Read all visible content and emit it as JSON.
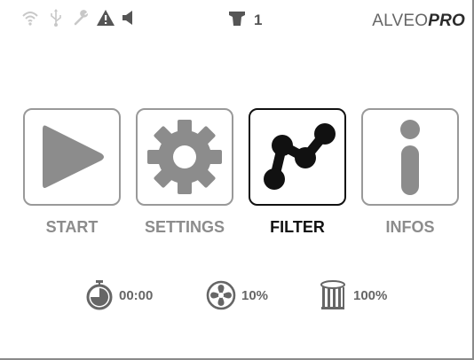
{
  "status_bar": {
    "icons": [
      "wifi-icon",
      "usb-icon",
      "wrench-icon",
      "warning-icon",
      "speaker-icon",
      "dock-icon"
    ],
    "dock_count": "1",
    "brand_light": "ALVEO",
    "brand_bold": "PRO"
  },
  "menu": {
    "items": [
      {
        "label": "START",
        "icon": "play-icon",
        "active": false
      },
      {
        "label": "SETTINGS",
        "icon": "gear-icon",
        "active": false
      },
      {
        "label": "FILTER",
        "icon": "filter-graph-icon",
        "active": true
      },
      {
        "label": "INFOS",
        "icon": "info-icon",
        "active": false
      }
    ]
  },
  "stats": {
    "timer": "00:00",
    "fan": "10%",
    "filter": "100%"
  },
  "colors": {
    "icon_gray": "#8c8c8c",
    "active": "#111111",
    "border": "#999999"
  }
}
